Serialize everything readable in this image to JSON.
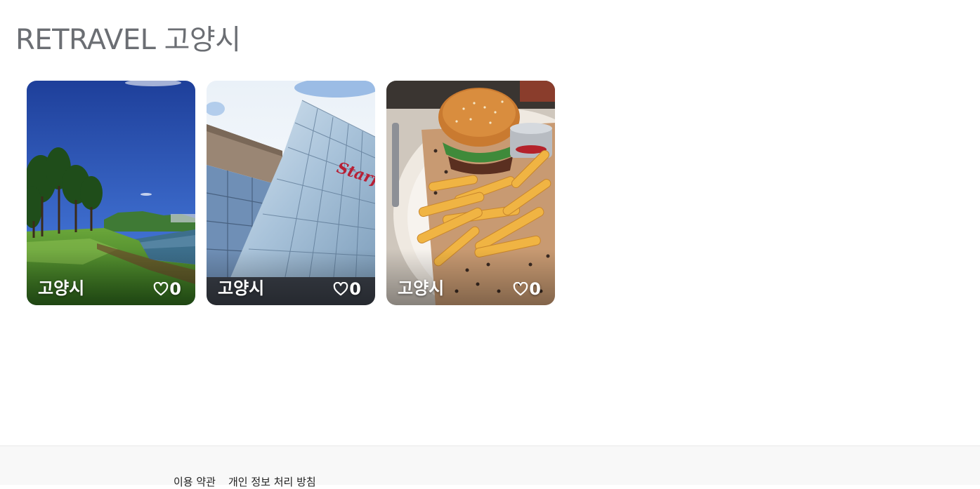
{
  "page": {
    "title": "RETRAVEL 고양시"
  },
  "cards": [
    {
      "label": "고양시",
      "likes": "0",
      "image": "park-lake-photo"
    },
    {
      "label": "고양시",
      "likes": "0",
      "image": "glass-building-photo"
    },
    {
      "label": "고양시",
      "likes": "0",
      "image": "burger-fries-photo"
    }
  ],
  "footer": {
    "links": [
      "이용 약관",
      "개인 정보 처리 방침"
    ]
  },
  "colors": {
    "title": "#6b6e73",
    "footer_bg": "#f8f8f8",
    "card_text": "#ffffff"
  }
}
